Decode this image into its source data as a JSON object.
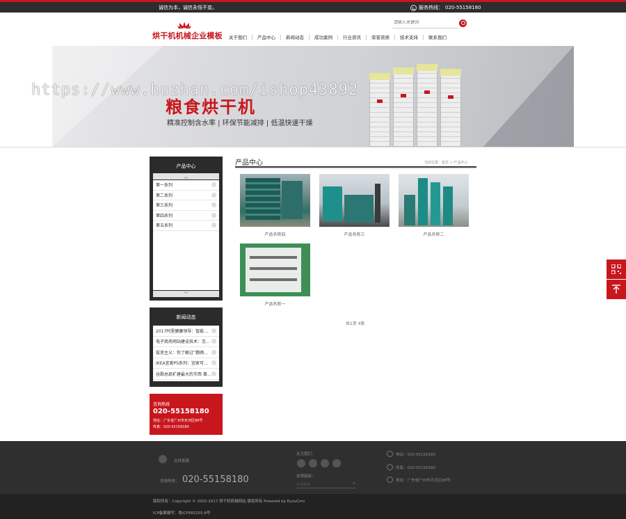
{
  "topbar": {
    "slogan": "诚信为本，诚信永恒不变。",
    "hotline_label": "服务热线：",
    "hotline": "020-55158180"
  },
  "header": {
    "logo_text": "烘干机机械企业模板",
    "search_placeholder": "请输入关键词"
  },
  "nav": [
    "关于我们",
    "产品中心",
    "新闻动态",
    "成功案例",
    "行业资讯",
    "荣誉资质",
    "技术支持",
    "联系我们"
  ],
  "banner": {
    "title": "粮食烘干机",
    "subtitle": "精准控制含水率 | 环保节能减排 | 低温快速干燥",
    "watermark": "https://www.huzhan.com/ishop43892"
  },
  "sidebar": {
    "product_title": "产品中心",
    "product_items": [
      "第一系列",
      "第二系列",
      "第三系列",
      "第四系列",
      "第五系列"
    ],
    "news_title": "新闻动态",
    "news_items": [
      "2017阿里健康领导：智能卫...",
      "电子商务网站建设技术：怎...",
      "投资主义：你了解过“鹦鹉...",
      "IKEA宜家PS系列：宜家可以...",
      "谷歌总部扩建最大的节西 事..."
    ],
    "contact": {
      "label": "咨询热线",
      "phone": "020-55158180",
      "address": "地址：广东省广州市天河区88号",
      "fax": "传真：020-55158180"
    }
  },
  "main": {
    "title": "产品中心",
    "breadcrumb": "当前位置：首页 > 产品中心",
    "products": [
      "产品名称四",
      "产品名称三",
      "产品名称二",
      "产品名称一"
    ],
    "pager": "共1页 4条"
  },
  "footer": {
    "qq": "在线客服",
    "hotline_label": "咨询热线：",
    "hotline": "020-55158180",
    "follow_label": "关注我们：",
    "links_label": "友情链接：",
    "links_select": "友情链接",
    "phone": "电话：020-55158180",
    "fax": "传真：020-55158180",
    "address": "地址：广东省广州市天河区88号",
    "copyright": "版权所有：Copyright © 2002-2017 烘干机机械网站 版权所有 Powered by EyouCms",
    "icp": "ICP备案编号：粤ICP565255-8号"
  },
  "colors": {
    "brand_red": "#c8161d",
    "dark": "#2b2b2b"
  }
}
